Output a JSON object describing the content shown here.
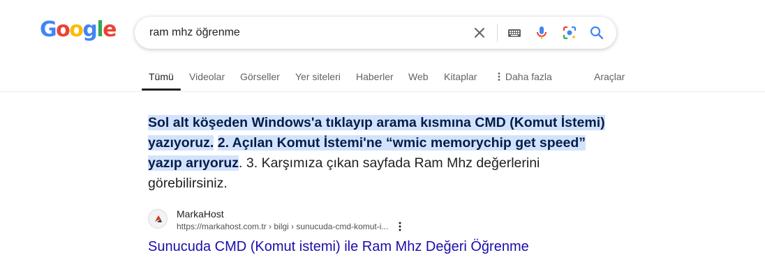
{
  "logo": {
    "letters": [
      "G",
      "o",
      "o",
      "g",
      "l",
      "e"
    ],
    "colors": [
      "#4285f4",
      "#ea4335",
      "#fbbc05",
      "#4285f4",
      "#34a853",
      "#ea4335"
    ]
  },
  "search": {
    "query": "ram mhz öğrenme"
  },
  "icons": {
    "clear": "close-icon",
    "keyboard": "keyboard-icon",
    "voice": "microphone-icon",
    "lens": "google-lens-icon",
    "search": "search-icon",
    "more": "more-vert-icon"
  },
  "tabs": {
    "items": [
      "Tümü",
      "Videolar",
      "Görseller",
      "Yer siteleri",
      "Haberler",
      "Web",
      "Kitaplar",
      "Daha fazla"
    ],
    "tools": "Araçlar"
  },
  "snippet": {
    "highlight_1": "Sol alt köşeden Windows'a tıklayıp arama kısmına CMD (Komut İstemi) yazıyoruz.",
    "space": " ",
    "highlight_2": "2. Açılan Komut İstemi'ne “wmic memorychip get speed” yazıp arıyoruz",
    "rest": ". 3. Karşımıza çıkan sayfada Ram Mhz değerlerini görebilirsiniz."
  },
  "source": {
    "site_name": "MarkaHost",
    "url": "https://markahost.com.tr › bilgi › sunucuda-cmd-komut-i...",
    "title": "Sunucuda CMD (Komut istemi) ile Ram Mhz Değeri Öğrenme"
  },
  "colors": {
    "accent": "#1a73e8",
    "link": "#1a0dab",
    "highlight": "#d3e3fd"
  }
}
